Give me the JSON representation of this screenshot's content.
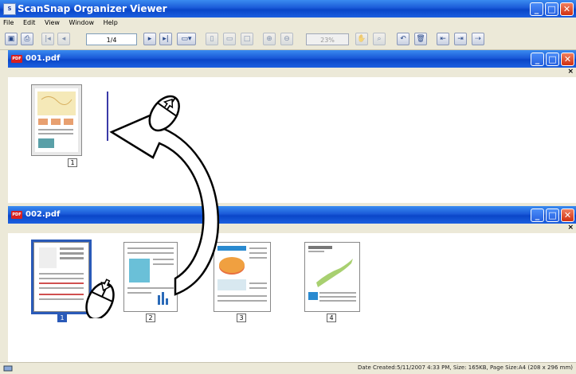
{
  "app": {
    "title": "ScanSnap Organizer Viewer",
    "icon": "scansnap-app-icon"
  },
  "menu": [
    "File",
    "Edit",
    "View",
    "Window",
    "Help"
  ],
  "toolbar": {
    "page_value": "1/4",
    "zoom_value": "23%"
  },
  "window1": {
    "title": "001.pdf",
    "pages": [
      {
        "num": "1"
      }
    ]
  },
  "window2": {
    "title": "002.pdf",
    "pages": [
      {
        "num": "1"
      },
      {
        "num": "2"
      },
      {
        "num": "3"
      },
      {
        "num": "4"
      }
    ],
    "selected": "1"
  },
  "status": {
    "text": "Date Created:5/11/2007 4:33 PM, Size: 165KB, Page Size:A4 (208 x 296 mm)"
  },
  "colors": {
    "titlebar": "#0a46c8",
    "selection": "#2a5ab8",
    "close": "#d03010"
  }
}
